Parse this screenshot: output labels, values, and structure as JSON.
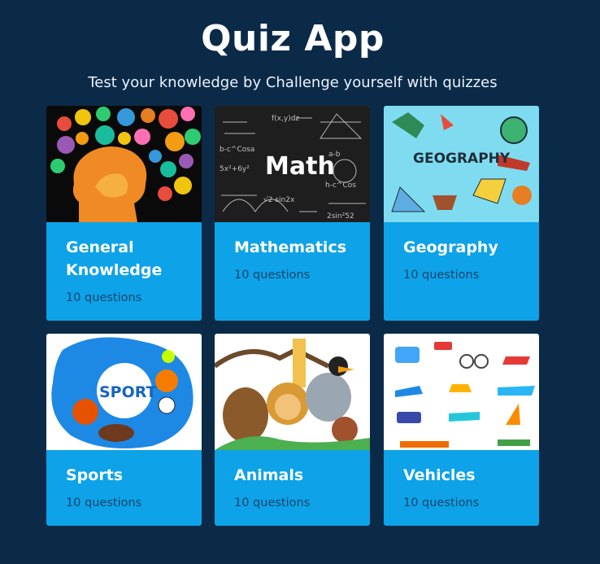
{
  "header": {
    "title": "Quiz App",
    "subtitle": "Test your knowledge by Challenge yourself with quizzes"
  },
  "categories": [
    {
      "name": "General Knowledge",
      "count": "10 questions",
      "image": "brain-illustration"
    },
    {
      "name": "Mathematics",
      "count": "10 questions",
      "image": "math-chalkboard",
      "image_text": "Math"
    },
    {
      "name": "Geography",
      "count": "10 questions",
      "image": "geography-doodles",
      "image_text": "GEOGRAPHY"
    },
    {
      "name": "Sports",
      "count": "10 questions",
      "image": "sports-balls",
      "image_text": "SPORT"
    },
    {
      "name": "Animals",
      "count": "10 questions",
      "image": "cartoon-animals"
    },
    {
      "name": "Vehicles",
      "count": "10 questions",
      "image": "vehicle-stickers"
    }
  ],
  "colors": {
    "background": "#0b2a48",
    "card": "#0ea2e8",
    "count_text": "#14466c"
  }
}
